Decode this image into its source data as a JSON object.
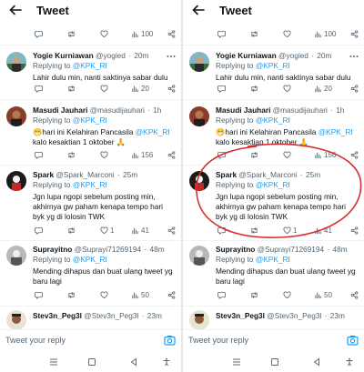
{
  "header": {
    "title": "Tweet"
  },
  "top_actions": {
    "views": "100"
  },
  "tweets": [
    {
      "name": "Yogie Kurniawan",
      "handle": "@yogied",
      "time": "20m",
      "replying_label": "Replying to",
      "replying_to": "@KPK_RI",
      "lines": [
        "Lahir dulu min, nanti saktinya sabar dulu"
      ],
      "views": "20"
    },
    {
      "name": "Masudi Jauhari",
      "handle": "@masudijauhari",
      "time": "1h",
      "replying_label": "Replying to",
      "replying_to": "@KPK_RI",
      "line1_prefix": "hari ini  Kelahiran Pancasila ",
      "line1_mention": "@KPK_RI",
      "line2": "kalo kesaktian 1 oktober ",
      "views": "156"
    },
    {
      "name": "Spark",
      "handle": "@Spark_Marconi",
      "time": "25m",
      "replying_label": "Replying to",
      "replying_to": "@KPK_RI",
      "lines": [
        "Jgn lupa ngopi sebelum posting min,",
        "akhirnya gw paham kenapa tempo hari",
        "byk yg di lolosin TWK"
      ],
      "likes": "1",
      "views": "41"
    },
    {
      "name": "Suprayitno",
      "handle": "@Suprayi71269194",
      "time": "48m",
      "replying_label": "Replying to",
      "replying_to": "@KPK_RI",
      "lines": [
        "Mending dihapus dan buat ulang tweet yg",
        "baru lagi"
      ],
      "views": "50"
    },
    {
      "name": "Stev3n_Peg3l",
      "handle": "@Stev3n_Peg3l",
      "time": "23m"
    }
  ],
  "reply_bar": {
    "placeholder": "Tweet your reply"
  },
  "icons": {
    "reply": "speech-bubble-icon",
    "retweet": "retweet-icon",
    "like": "heart-icon",
    "views": "bar-chart-icon",
    "share": "share-icon",
    "camera": "camera-icon",
    "back": "back-arrow-icon",
    "folded_hands": "folded-hands-emoji",
    "grinning": "grinning-emoji"
  },
  "colors": {
    "link": "#1d9bf0",
    "secondary_text": "#536471",
    "highlight": "#d32f2f",
    "camera": "#1d9bf0"
  }
}
